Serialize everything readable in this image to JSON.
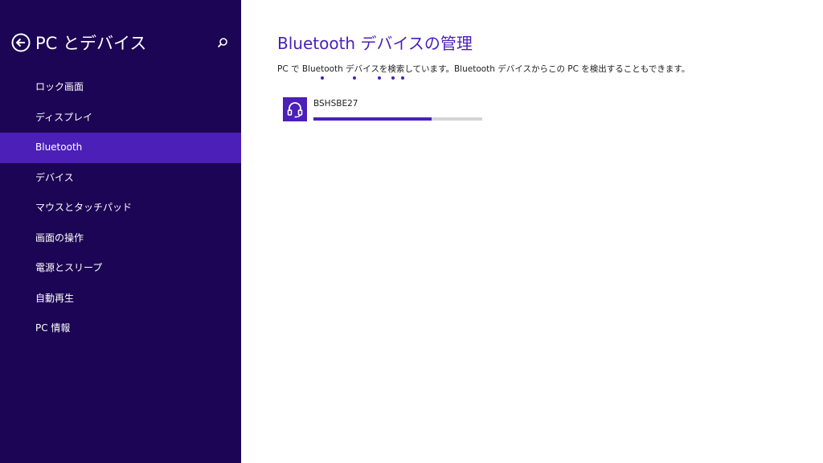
{
  "sidebar": {
    "title": "PC とデバイス",
    "back_icon": "back-arrow-icon",
    "search_icon": "search-icon",
    "items": [
      {
        "label": "ロック画面",
        "selected": false
      },
      {
        "label": "ディスプレイ",
        "selected": false
      },
      {
        "label": "Bluetooth",
        "selected": true
      },
      {
        "label": "デバイス",
        "selected": false
      },
      {
        "label": "マウスとタッチパッド",
        "selected": false
      },
      {
        "label": "画面の操作",
        "selected": false
      },
      {
        "label": "電源とスリープ",
        "selected": false
      },
      {
        "label": "自動再生",
        "selected": false
      },
      {
        "label": "PC 情報",
        "selected": false
      }
    ]
  },
  "main": {
    "title": "Bluetooth デバイスの管理",
    "status": "PC で Bluetooth デバイスを検索しています。Bluetooth デバイスからこの PC を検出することもできます。",
    "device": {
      "name": "BSHSBE27",
      "icon": "headset-icon",
      "progress": 0.7
    }
  },
  "colors": {
    "sidebar_bg": "#1c0554",
    "accent": "#4b1fb8",
    "progress_track": "#d4d4d4"
  }
}
